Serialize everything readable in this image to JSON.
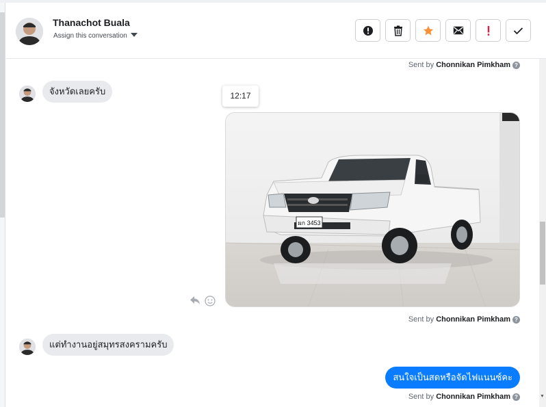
{
  "header": {
    "contact_name": "Thanachot Buala",
    "assign_label": "Assign this conversation",
    "actions": [
      {
        "name": "spam-button",
        "icon": "alert-circle-icon"
      },
      {
        "name": "delete-button",
        "icon": "trash-icon"
      },
      {
        "name": "star-button",
        "icon": "star-icon",
        "color": "#f7923b"
      },
      {
        "name": "mark-unread-button",
        "icon": "envelope-icon"
      },
      {
        "name": "important-button",
        "icon": "exclamation-icon",
        "color": "#e41e3f"
      },
      {
        "name": "done-button",
        "icon": "check-icon"
      }
    ]
  },
  "messages": {
    "sent_by_prefix": "Sent by",
    "sent_by_name": "Chonnikan Pimkham",
    "incoming_1": "จังหวัดเลยครับ",
    "time_chip": "12:17",
    "photo_plate": "ผก 3453",
    "incoming_2": "แต่ทำงานอยู่สมุทรสงครามครับ",
    "outgoing_1": "สนใจเป็นสดหรือจัดไฟแนนซ์คะ"
  },
  "colors": {
    "accent": "#0a7cff",
    "incoming_bubble": "#e9eaed"
  }
}
